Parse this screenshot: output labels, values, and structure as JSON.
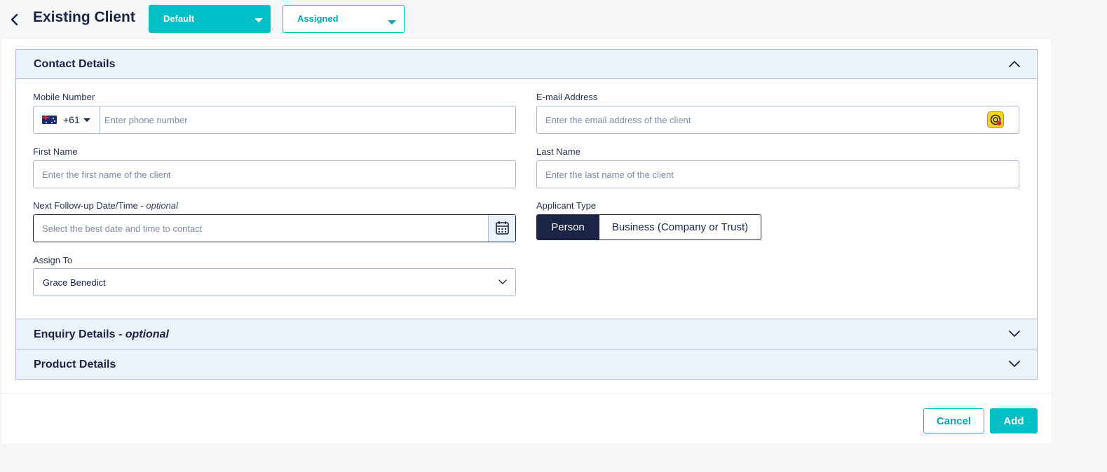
{
  "header": {
    "title": "Existing Client",
    "template_dropdown": "Default",
    "status_dropdown": "Assigned"
  },
  "sections": {
    "contact": {
      "title": "Contact Details",
      "expanded": true
    },
    "enquiry": {
      "title": "Enquiry Details",
      "optional": "- optional",
      "expanded": false
    },
    "product": {
      "title": "Product Details",
      "expanded": false
    }
  },
  "form": {
    "mobile": {
      "label": "Mobile Number",
      "dial_code": "+61",
      "country_flag": "australia-flag",
      "placeholder": "Enter phone number",
      "value": ""
    },
    "email": {
      "label": "E-mail Address",
      "placeholder": "Enter the email address of the client",
      "value": ""
    },
    "first_name": {
      "label": "First Name",
      "placeholder": "Enter the first name of the client",
      "value": ""
    },
    "last_name": {
      "label": "Last Name",
      "placeholder": "Enter the last name of the client",
      "value": ""
    },
    "follow_up": {
      "label": "Next Follow-up Date/Time -",
      "optional": "optional",
      "placeholder": "Select the best date and time to contact",
      "value": ""
    },
    "applicant_type": {
      "label": "Applicant Type",
      "options": [
        "Person",
        "Business (Company or Trust)"
      ],
      "selected": "Person"
    },
    "assign_to": {
      "label": "Assign To",
      "value": "Grace Benedict"
    }
  },
  "footer": {
    "cancel": "Cancel",
    "add": "Add"
  },
  "colors": {
    "accent": "#00bfc6",
    "navy": "#1b2347",
    "section_bg": "#ecf2fc",
    "border": "#a9b8d2",
    "page_bg": "#f6f7f9"
  }
}
